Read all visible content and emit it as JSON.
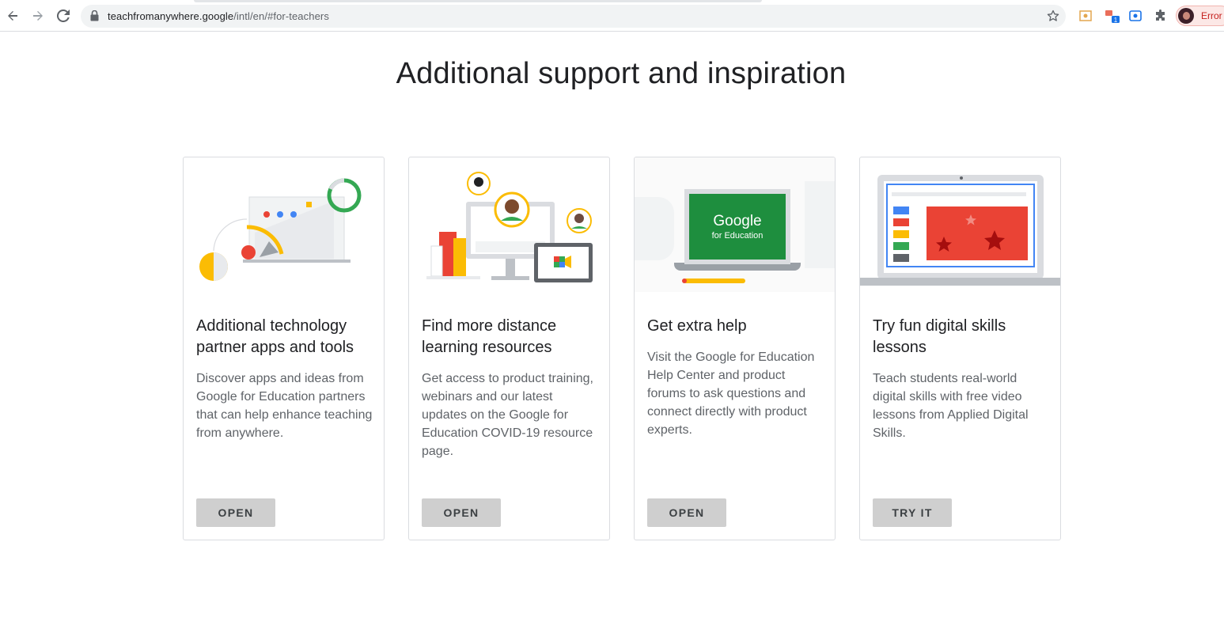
{
  "browser": {
    "url_domain": "teachfromanywhere.google",
    "url_path": "/intl/en/#for-teachers",
    "profile_status": "Error"
  },
  "page": {
    "heading": "Additional support and inspiration"
  },
  "cards": [
    {
      "title": "Additional technology partner apps and tools",
      "description": "Discover apps and ideas from Google for Education partners that can help enhance teaching from anywhere.",
      "button": "OPEN"
    },
    {
      "title": "Find more distance learning resources",
      "description": "Get access to product training, webinars and our latest updates on the Google for Education COVID-19 resource page.",
      "button": "OPEN"
    },
    {
      "title": "Get extra help",
      "description": "Visit the Google for Education Help Center and product forums to ask questions and connect directly with product experts.",
      "button": "OPEN",
      "image_text": {
        "brand": "Google",
        "sub": "for Education"
      }
    },
    {
      "title": "Try fun digital skills lessons",
      "description": "Teach students real-world digital skills with free video lessons from Applied Digital Skills.",
      "button": "TRY IT"
    }
  ],
  "icons": [
    "back-icon",
    "forward-icon",
    "reload-icon",
    "lock-icon",
    "star-icon",
    "screenshot-extension-icon",
    "translate-extension-icon",
    "screen-record-extension-icon",
    "extensions-puzzle-icon",
    "profile-avatar"
  ],
  "colors": {
    "google_green": "#34a853",
    "google_red": "#ea4335",
    "google_yellow": "#fbbc04",
    "google_blue": "#4285f4",
    "button_gray": "#cfcfcf"
  }
}
